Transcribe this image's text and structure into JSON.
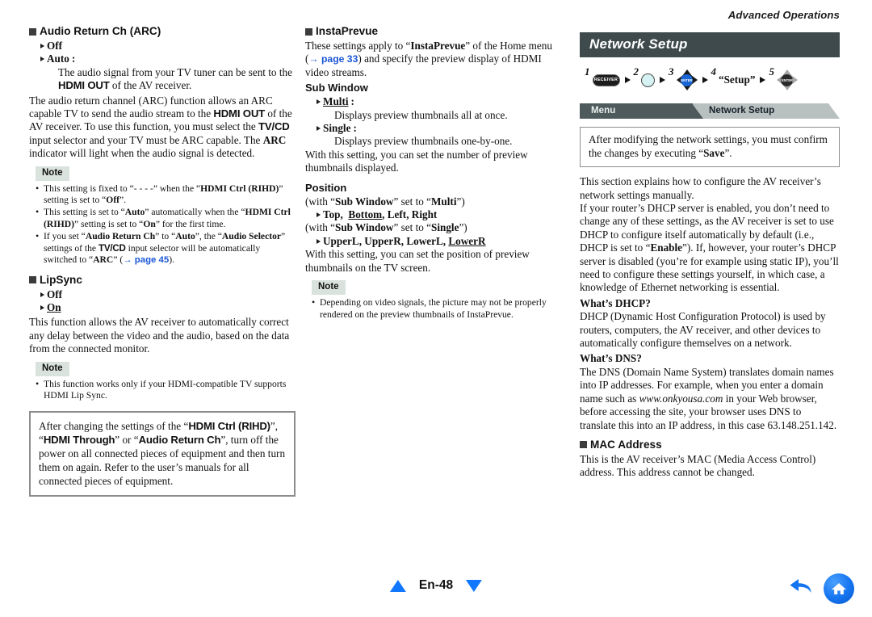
{
  "page": {
    "number_label": "En-48",
    "kicker": "Advanced Operations"
  },
  "column1": {
    "arc": {
      "heading": "Audio Return Ch (ARC)",
      "options": [
        {
          "label": "Off",
          "suffix": ""
        },
        {
          "label": "Auto",
          "suffix": ":"
        }
      ],
      "auto_desc": "The audio signal from your TV tuner can be sent to the HDMI OUT of the AV receiver.",
      "auto_desc_p1": "The audio signal from your TV tuner can be sent to",
      "auto_desc_p2_a": "the ",
      "auto_desc_bold": "HDMI OUT",
      "auto_desc_p2_b": " of the AV receiver.",
      "body_1": "The audio return channel (ARC) function allows an ARC capable TV to send the audio stream to the ",
      "body_bold_1": "HDMI OUT",
      "body_2": " of the AV receiver. To use this function, you must select the ",
      "body_bold_2": "TV/CD",
      "body_3": " input selector and your TV must be ARC capable. The ",
      "body_bold_3": "ARC",
      "body_4": " indicator will light when the audio signal is detected.",
      "note_label": "Note",
      "notes": [
        {
          "p1": "This setting is fixed to “- - - -” when the “",
          "b1": "HDMI Ctrl (RIHD)",
          "p2": "” setting is set to “",
          "b2": "Off",
          "p3": "”."
        },
        {
          "p1": "This setting is set to “",
          "b1": "Auto",
          "p2": "” automatically when the “",
          "b2": "HDMI Ctrl (RIHD)",
          "p3": "” setting is set to “",
          "b3": "On",
          "p4": "” for the first time."
        },
        {
          "p1": "If you set “",
          "b1": "Audio Return Ch",
          "p2": "” to “",
          "b2": "Auto",
          "p3": "”, the “",
          "b3": "Audio Selector",
          "p4": "” settings of the ",
          "b4": "TV/CD",
          "p5": " input selector will be automatically switched to “",
          "b5": "ARC",
          "p6": "” (",
          "link": "→ page 45",
          "p7": ")."
        }
      ]
    },
    "lipsync": {
      "heading": "LipSync",
      "options": [
        {
          "label": "Off",
          "underline": false
        },
        {
          "label": "On",
          "underline": true
        }
      ],
      "body": "This function allows the AV receiver to automatically correct any delay between the video and the audio, based on the data from the connected monitor.",
      "note_label": "Note",
      "note": "This function works only if your HDMI-compatible TV supports HDMI Lip Sync."
    },
    "callout": {
      "p1": "After changing the settings of the “",
      "b1": "HDMI Ctrl (RIHD)",
      "p2": "”, “",
      "b2": "HDMI Through",
      "p3": "” or “",
      "b3": "Audio Return Ch",
      "p4": "”, turn off the power on all connected pieces of equipment and then turn them on again. Refer to the user’s manuals for all connected pieces of equipment."
    }
  },
  "column2": {
    "instaprevue": {
      "heading": "InstaPrevue",
      "intro_p1": "These settings apply to “",
      "intro_b1": "InstaPrevue",
      "intro_p2": "” of the Home menu (",
      "intro_link": "→ page 33",
      "intro_p3": ") and specify the preview display of HDMI video streams."
    },
    "sub_window": {
      "heading": "Sub Window",
      "options": [
        {
          "label": "Multi",
          "underline": true,
          "suffix": ":",
          "desc": "Displays preview thumbnails all at once."
        },
        {
          "label": "Single",
          "underline": false,
          "suffix": ":",
          "desc": "Displays preview thumbnails one-by-one."
        }
      ],
      "body": "With this setting, you can set the number of preview thumbnails displayed."
    },
    "position": {
      "heading": "Position",
      "cond_multi_p1": "(with “",
      "cond_multi_b1": "Sub Window",
      "cond_multi_p2": "” set to “",
      "cond_multi_b2": "Multi",
      "cond_multi_p3": "”)",
      "multi_values": [
        "Top",
        "Bottom",
        "Left",
        "Right"
      ],
      "multi_underlined": "Bottom",
      "cond_single_p1": "(with “",
      "cond_single_b1": "Sub Window",
      "cond_single_p2": "” set to “",
      "cond_single_b2": "Single",
      "cond_single_p3": "”)",
      "single_values": [
        "UpperL",
        "UpperR",
        "LowerL",
        "LowerR"
      ],
      "single_underlined": "LowerR",
      "body": "With this setting, you can set the position of preview thumbnails on the TV screen.",
      "note_label": "Note",
      "note": "Depending on video signals, the picture may not be properly rendered on the preview thumbnails of InstaPrevue."
    }
  },
  "column3": {
    "title": "Network Setup",
    "steps": [
      {
        "num": "1",
        "icon": "receiver-button",
        "label": "RECEIVER"
      },
      {
        "num": "2",
        "icon": "round-button",
        "label": ""
      },
      {
        "num": "3",
        "icon": "dpad-enter-blue",
        "label": "ENTER"
      },
      {
        "num": "4",
        "icon": "text",
        "label": "“Setup”"
      },
      {
        "num": "5",
        "icon": "dpad-enter-grey",
        "label": "ENTER"
      }
    ],
    "breadcrumb": {
      "menu": "Menu",
      "current": "Network Setup"
    },
    "save_box": {
      "p1": "After modifying the network settings, you must confirm the changes by executing “",
      "b1": "Save",
      "p2": "”."
    },
    "body_1": "This section explains how to configure the AV receiver’s network settings manually.",
    "body_2_p1": "If your router’s DHCP server is enabled, you don’t need to change any of these settings, as the AV receiver is set to use DHCP to configure itself automatically by default (i.e., DHCP is set to “",
    "body_2_b1": "Enable",
    "body_2_p2": "”). If, however, your router’s DHCP server is disabled (you’re for example using static IP), you’ll need to configure these settings yourself, in which case, a knowledge of Ethernet networking is essential.",
    "dhcp": {
      "heading": "What’s DHCP?",
      "body": "DHCP (Dynamic Host Configuration Protocol) is used by routers, computers, the AV receiver, and other devices to automatically configure themselves on a network."
    },
    "dns": {
      "heading": "What’s DNS?",
      "p1": "The DNS (Domain Name System) translates domain names into IP addresses. For example, when you enter a domain name such as ",
      "i1": "www.onkyousa.com",
      "p2": " in your Web browser, before accessing the site, your browser uses DNS to translate this into an IP address, in this case 63.148.251.142."
    },
    "mac": {
      "heading": "MAC Address",
      "body": "This is the AV receiver’s MAC (Media Access Control) address. This address cannot be changed."
    }
  }
}
